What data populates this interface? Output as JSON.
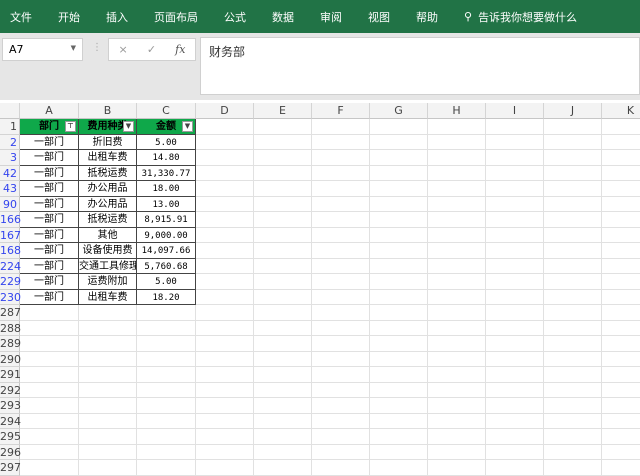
{
  "ribbon": {
    "tabs": [
      "文件",
      "开始",
      "插入",
      "页面布局",
      "公式",
      "数据",
      "审阅",
      "视图",
      "帮助"
    ],
    "search": "告诉我你想要做什么"
  },
  "formula_bar": {
    "name_box": "A7",
    "cancel": "×",
    "enter": "✓",
    "fx": "fx",
    "value": "财务部"
  },
  "columns": [
    "A",
    "B",
    "C",
    "D",
    "E",
    "F",
    "G",
    "H",
    "I",
    "J",
    "K"
  ],
  "header_row": {
    "row": "1",
    "cells": [
      "部门",
      "费用种类",
      "金额"
    ]
  },
  "rows": [
    {
      "row": "2",
      "cells": [
        "一部门",
        "折旧费",
        "5.00"
      ]
    },
    {
      "row": "3",
      "cells": [
        "一部门",
        "出租车费",
        "14.80"
      ]
    },
    {
      "row": "42",
      "cells": [
        "一部门",
        "抵税运费",
        "31,330.77"
      ]
    },
    {
      "row": "43",
      "cells": [
        "一部门",
        "办公用品",
        "18.00"
      ]
    },
    {
      "row": "90",
      "cells": [
        "一部门",
        "办公用品",
        "13.00"
      ]
    },
    {
      "row": "166",
      "cells": [
        "一部门",
        "抵税运费",
        "8,915.91"
      ]
    },
    {
      "row": "167",
      "cells": [
        "一部门",
        "其他",
        "9,000.00"
      ]
    },
    {
      "row": "168",
      "cells": [
        "一部门",
        "设备使用费",
        "14,097.66"
      ]
    },
    {
      "row": "224",
      "cells": [
        "一部门",
        "交通工具修理",
        "5,760.68"
      ]
    },
    {
      "row": "229",
      "cells": [
        "一部门",
        "运费附加",
        "5.00"
      ]
    },
    {
      "row": "230",
      "cells": [
        "一部门",
        "出租车费",
        "18.20"
      ]
    }
  ],
  "empty_rows": [
    "287",
    "288",
    "289",
    "290",
    "291",
    "292",
    "293",
    "294",
    "295",
    "296",
    "297"
  ],
  "colors": {
    "ribbon": "#217346",
    "header_fill": "#0fa84a",
    "filtered_row_number": "#3344ee"
  }
}
